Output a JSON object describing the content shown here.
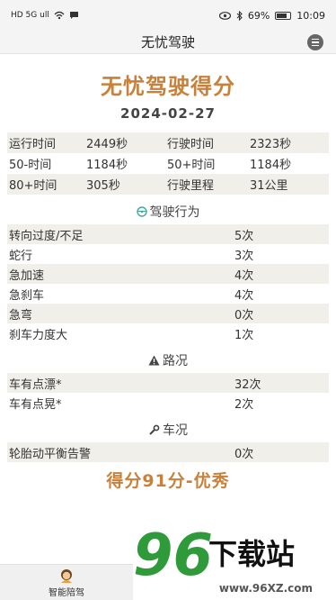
{
  "status_bar": {
    "left_icons": "HD 5G ull",
    "battery": "69%",
    "time": "10:09"
  },
  "nav": {
    "title": "无忧驾驶"
  },
  "hero": {
    "title": "无忧驾驶得分",
    "date": "2024-02-27"
  },
  "stats": [
    {
      "l1": "运行时间",
      "v1": "2449秒",
      "l2": "行驶时间",
      "v2": "2323秒"
    },
    {
      "l1": "50-时间",
      "v1": "1184秒",
      "l2": "50+时间",
      "v2": "1184秒"
    },
    {
      "l1": "80+时间",
      "v1": "305秒",
      "l2": "行驶里程",
      "v2": "31公里"
    }
  ],
  "behavior": {
    "title": "驾驶行为",
    "items": [
      {
        "label": "转向过度/不足",
        "value": "5次"
      },
      {
        "label": "蛇行",
        "value": "3次"
      },
      {
        "label": "急加速",
        "value": "4次"
      },
      {
        "label": "急刹车",
        "value": "4次"
      },
      {
        "label": "急弯",
        "value": "0次"
      },
      {
        "label": "刹车力度大",
        "value": "1次"
      }
    ]
  },
  "road": {
    "title": "路况",
    "items": [
      {
        "label": "车有点漂*",
        "value": "32次"
      },
      {
        "label": "车有点晃*",
        "value": "2次"
      }
    ]
  },
  "vehicle": {
    "title": "车况",
    "items": [
      {
        "label": "轮胎动平衡告警",
        "value": "0次"
      }
    ]
  },
  "score": "得分91分-优秀",
  "bottom_tab": {
    "label": "智能陪驾"
  },
  "watermark": {
    "num": "96",
    "text": "下载站",
    "url": "www.96XZ.com"
  },
  "colors": {
    "accent": "#c8813a",
    "stripe": "#f1efe9"
  }
}
